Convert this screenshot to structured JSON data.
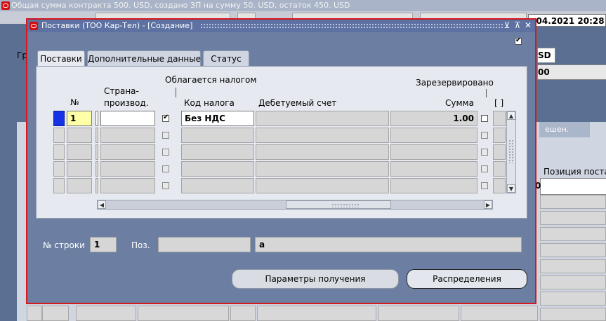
{
  "background_window": {
    "title": "Общая сумма контракта 500. USD, создано ЗП на сумму 50. USD, остаток 450. USD",
    "datetime": ".04.2021 20:28:0",
    "field_sd": "SD",
    "field_00": "00",
    "left_label_partial": "Гр",
    "tab_partial": "ешен.",
    "column_label_partial": "Позиция поста",
    "cell_partial": "0"
  },
  "dialog": {
    "title": "Поставки (ТОО Кар-Тел) - [Создание]",
    "buttons": {
      "minimize": "⊻",
      "maximize": "⊼",
      "close": "✕"
    },
    "tabs": [
      "Поставки",
      "Дополнительные данные",
      "Статус"
    ],
    "active_tab": "Поставки",
    "group_headers": {
      "taxable": "Облагается налогом",
      "reserved": "Зарезервировано"
    },
    "columns": {
      "num": "№",
      "country_line1": "Страна-",
      "country_line2": "производ.",
      "tax_code": "Код налога",
      "debit_account": "Дебетуемый счет",
      "amount": "Сумма",
      "flag": "[ ]"
    },
    "rows": [
      {
        "num": "1",
        "country": "",
        "taxable": true,
        "tax_code": "Без НДС",
        "debit_account": "",
        "amount": "1.00",
        "reserved": false
      },
      {
        "num": "",
        "country": "",
        "taxable": false,
        "tax_code": "",
        "debit_account": "",
        "amount": "",
        "reserved": false
      },
      {
        "num": "",
        "country": "",
        "taxable": false,
        "tax_code": "",
        "debit_account": "",
        "amount": "",
        "reserved": false
      },
      {
        "num": "",
        "country": "",
        "taxable": false,
        "tax_code": "",
        "debit_account": "",
        "amount": "",
        "reserved": false
      },
      {
        "num": "",
        "country": "",
        "taxable": false,
        "tax_code": "",
        "debit_account": "",
        "amount": "",
        "reserved": false
      }
    ],
    "footer": {
      "row_num_label": "№ строки",
      "row_num_value": "1",
      "pos_label": "Поз.",
      "pos_value": "",
      "extra_value": "а"
    },
    "actions": {
      "receiving_params": "Параметры получения",
      "distributions": "Распределения"
    }
  },
  "colors": {
    "accent_border": "#d4181b",
    "current_record": "#1433e6",
    "current_field": "#ffffa8"
  }
}
